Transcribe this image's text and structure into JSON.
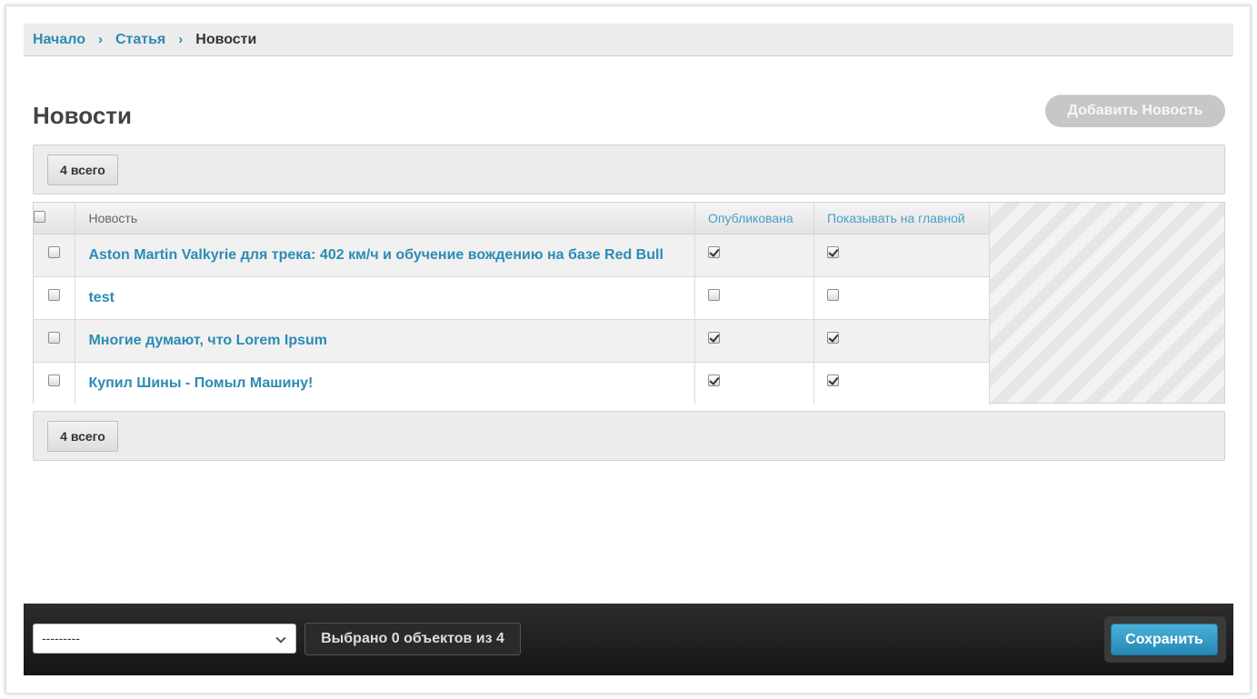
{
  "breadcrumb": {
    "items": [
      "Начало",
      "Статья"
    ],
    "current": "Новости",
    "separator": "›"
  },
  "page": {
    "title": "Новости",
    "add_button_label": "Добавить Новость"
  },
  "pager": {
    "top_count_label": "4 всего",
    "bottom_count_label": "4 всего"
  },
  "table": {
    "columns": {
      "title": "Новость",
      "published": "Опубликована",
      "show_on_main": "Показывать на главной"
    },
    "rows": [
      {
        "title": "Aston Martin Valkyrie для трека: 402 км/ч и обучение вождению на базе Red Bull",
        "selected": false,
        "published": true,
        "show_on_main": true
      },
      {
        "title": "test",
        "selected": false,
        "published": false,
        "show_on_main": false
      },
      {
        "title": "Многие думают, что Lorem Ipsum",
        "selected": false,
        "published": true,
        "show_on_main": true
      },
      {
        "title": "Купил Шины - Помыл Машину!",
        "selected": false,
        "published": true,
        "show_on_main": true
      }
    ]
  },
  "actions": {
    "select_value": "---------",
    "selected_counter": "Выбрано 0 объектов из 4",
    "save_label": "Сохранить"
  },
  "colors": {
    "link": "#2c8bb5",
    "save_button": "#2b95c2",
    "action_bar": "#1f1f1f"
  }
}
